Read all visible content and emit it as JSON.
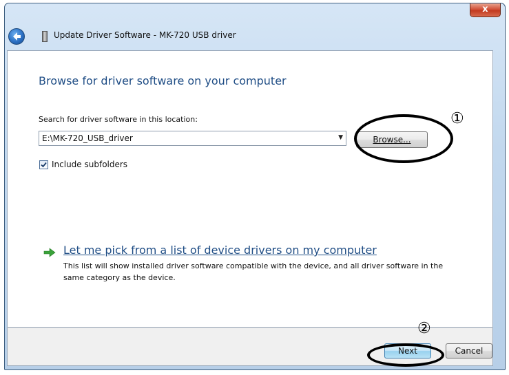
{
  "window": {
    "title": "Update Driver Software - MK-720 USB driver",
    "close_label": "x"
  },
  "main": {
    "heading": "Browse for driver software on your computer",
    "search_label": "Search for driver software in this location:",
    "path_value": "E:\\MK-720_USB_driver",
    "browse_label": "Browse...",
    "include_subfolders": {
      "label": "Include subfolders",
      "checked": true
    },
    "pick_link": "Let me pick from a list of device drivers on my computer",
    "pick_description": "This list will show installed driver software compatible with the device, and all driver software in the same category as the device."
  },
  "footer": {
    "next_label": "Next",
    "cancel_label": "Cancel"
  },
  "annotations": {
    "marker_1": "①",
    "marker_2": "②"
  },
  "colors": {
    "heading": "#1f4d85",
    "link": "#1f4d85",
    "arrow_green": "#3aa23a",
    "accent_blue": "#2b70c4"
  },
  "icons": [
    "back-arrow-icon",
    "usb-device-icon",
    "dropdown-arrow-icon",
    "checkmark-icon",
    "green-arrow-icon"
  ]
}
